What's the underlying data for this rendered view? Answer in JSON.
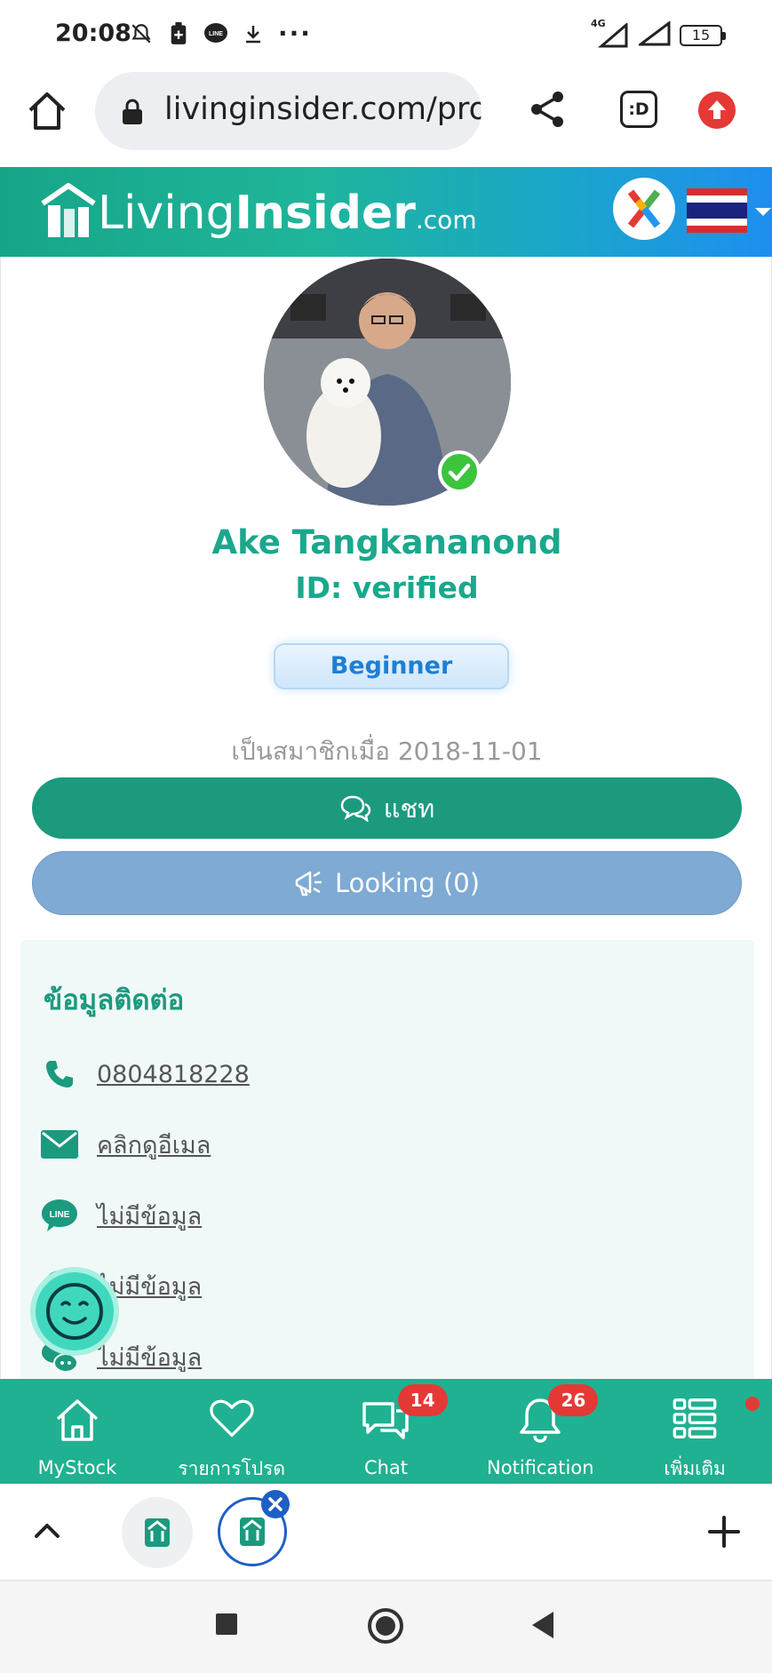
{
  "status_bar": {
    "time": "20:08",
    "notification_icons": [
      "muted-bell-icon",
      "battery-saver-icon",
      "line-app-icon",
      "download-icon"
    ],
    "more": "···",
    "network": "4G",
    "battery": "15"
  },
  "browser": {
    "url": "livinginsider.com/profile",
    "tabs_label": ":D"
  },
  "site": {
    "logo_light": "Living",
    "logo_bold": "Insider",
    "logo_suffix": ".com",
    "colors": {
      "primary": "#1b9a7e",
      "header_start": "#17a589",
      "header_end": "#1f8ef0",
      "looking": "#7eaad3",
      "badge": "#e53935"
    }
  },
  "profile": {
    "name": "Ake Tangkananond",
    "id_status": "ID: verified",
    "level": "Beginner",
    "member_since": "เป็นสมาชิกเมื่อ 2018-11-01",
    "chat_button": "แชท",
    "looking_button": "Looking (0)"
  },
  "contact": {
    "title": "ข้อมูลติดต่อ",
    "items": [
      {
        "icon": "phone-icon",
        "text": "0804818228"
      },
      {
        "icon": "email-icon",
        "text": "คลิกดูอีเมล"
      },
      {
        "icon": "line-icon",
        "text": "ไม่มีข้อมูล"
      },
      {
        "icon": "whatsapp-icon",
        "text": "ไม่มีข้อมูล"
      },
      {
        "icon": "wechat-icon",
        "text": "ไม่มีข้อมูล"
      }
    ]
  },
  "bottom_nav": [
    {
      "label": "MyStock",
      "icon": "home-icon"
    },
    {
      "label": "รายการโปรด",
      "icon": "heart-icon"
    },
    {
      "label": "Chat",
      "icon": "chat-icon",
      "badge": "14"
    },
    {
      "label": "Notification",
      "icon": "bell-icon",
      "badge": "26"
    },
    {
      "label": "เพิ่มเติม",
      "icon": "menu-list-icon"
    }
  ]
}
